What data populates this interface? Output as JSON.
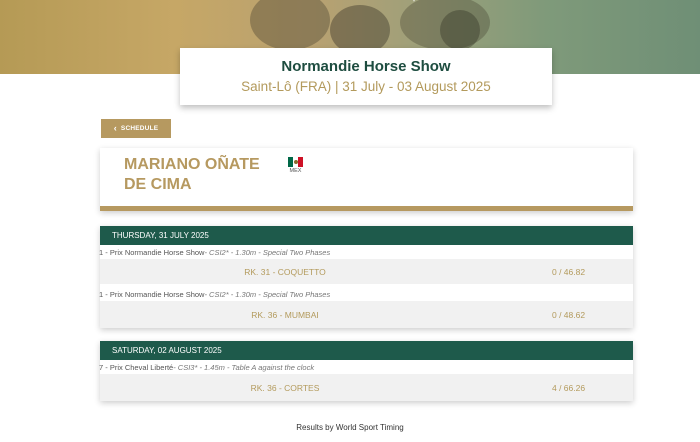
{
  "event": {
    "title": "Normandie Horse Show",
    "subtitle": "Saint-Lô (FRA) | 31 July - 03 August 2025"
  },
  "nav": {
    "back_label": "SCHEDULE"
  },
  "rider": {
    "name": "MARIANO OÑATE DE CIMA",
    "country_code": "MEX"
  },
  "days": [
    {
      "date": "THURSDAY, 31 JULY 2025",
      "competitions": [
        {
          "title": "1 - Prix Normandie Horse Show",
          "details": " - CSI2* - 1.30m - Special Two Phases",
          "rank_horse": "RK. 31 - COQUETTO",
          "score": "0 / 46.82"
        },
        {
          "title": "1 - Prix Normandie Horse Show",
          "details": " - CSI2* - 1.30m - Special Two Phases",
          "rank_horse": "RK. 36 - MUMBAI",
          "score": "0 / 48.62"
        }
      ]
    },
    {
      "date": "SATURDAY, 02 AUGUST 2025",
      "competitions": [
        {
          "title": "7 - Prix Cheval Liberté",
          "details": " - CSI3* - 1.45m - Table A against the clock",
          "rank_horse": "RK. 36 - CORTES",
          "score": "4 / 66.26"
        }
      ]
    }
  ],
  "footer": {
    "text": "Results by World Sport Timing"
  },
  "colors": {
    "primary_green": "#1e5a4b",
    "gold": "#b69960"
  }
}
